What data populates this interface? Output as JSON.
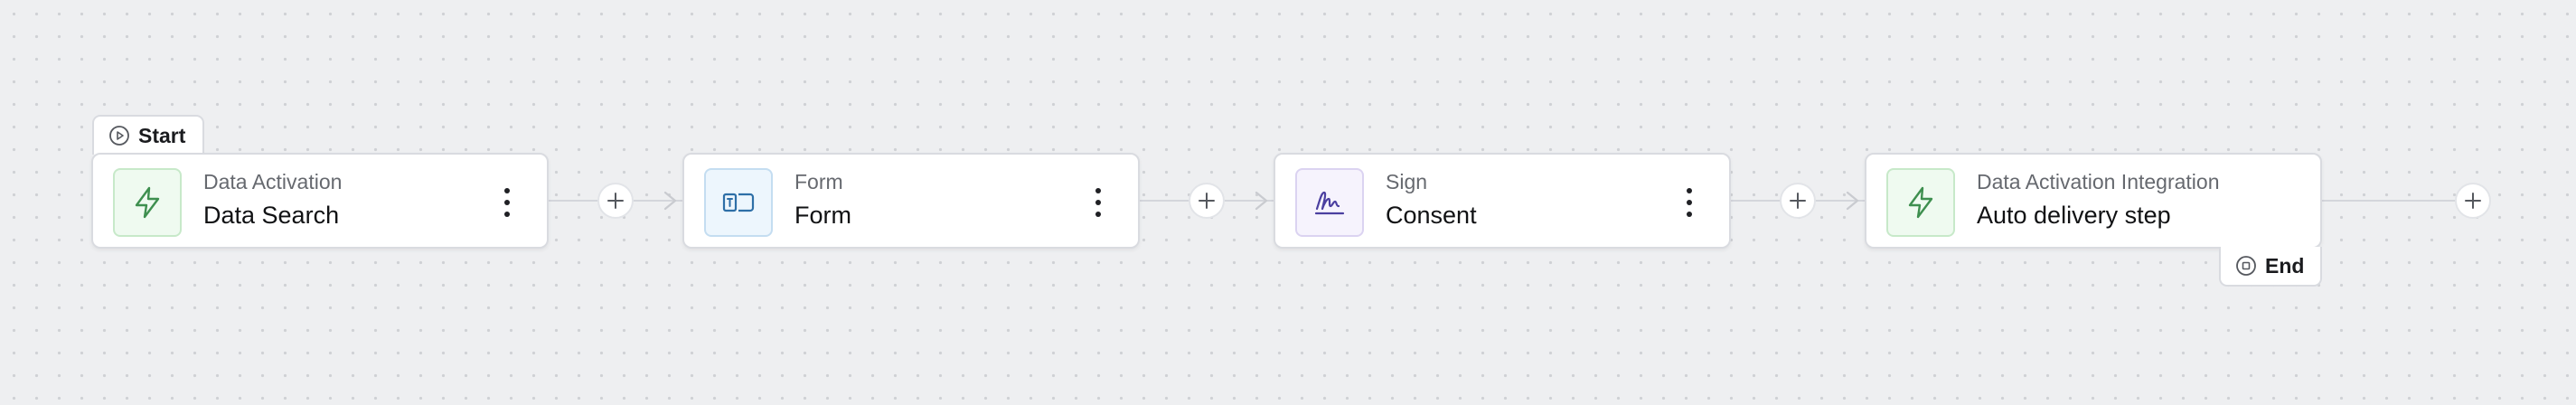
{
  "flow": {
    "start_label": "Start",
    "end_label": "End",
    "nodes": [
      {
        "category": "Data Activation",
        "title": "Data Search",
        "icon": "lightning-icon",
        "accent": "#3e8f4f"
      },
      {
        "category": "Form",
        "title": "Form",
        "icon": "form-icon",
        "accent": "#2e6fa7"
      },
      {
        "category": "Sign",
        "title": "Consent",
        "icon": "signature-icon",
        "accent": "#4b3fa0"
      },
      {
        "category": "Data Activation Integration",
        "title": "Auto delivery step",
        "icon": "lightning-icon",
        "accent": "#3e8f4f"
      }
    ]
  },
  "colors": {
    "canvas_bg": "#eeeff1",
    "node_border": "#d9dbe0",
    "connector": "#d4d6db"
  }
}
